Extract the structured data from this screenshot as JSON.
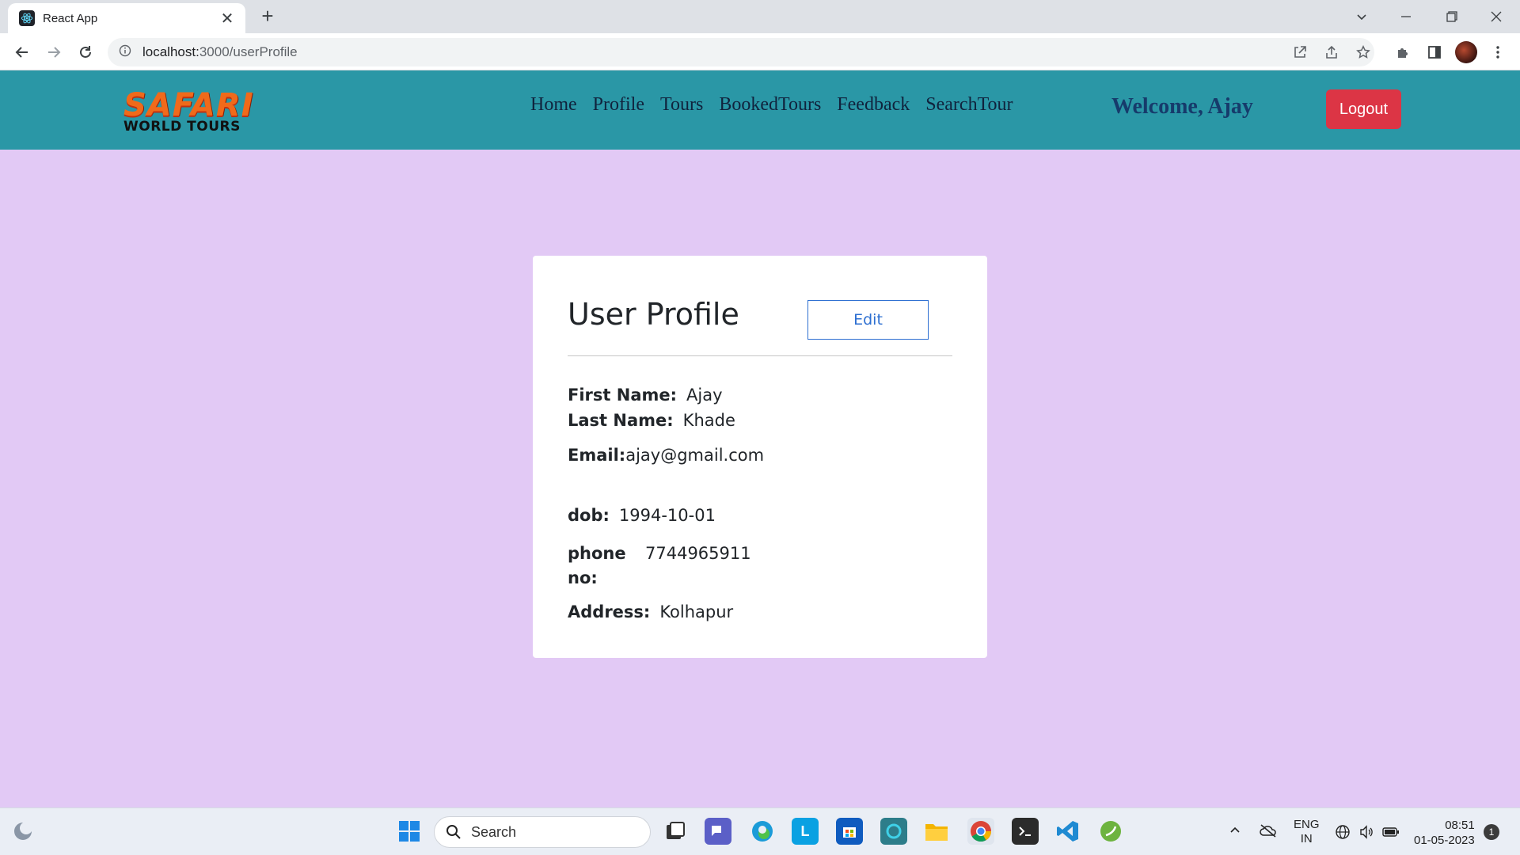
{
  "browser": {
    "tab_title": "React App",
    "new_tab": "+",
    "url_host": "localhost:",
    "url_path": "3000/userProfile"
  },
  "navbar": {
    "logo_top": "SAFARI",
    "logo_bottom": "WORLD TOURS",
    "menu": [
      "Home",
      "Profile",
      "Tours",
      "BookedTours",
      "Feedback",
      "SearchTour"
    ],
    "welcome": "Welcome, Ajay",
    "logout": "Logout",
    "bg_color": "#2a97a6",
    "logout_color": "#dc3545"
  },
  "profile": {
    "title": "User Profile",
    "edit_label": "Edit",
    "first_name_label": "First Name:",
    "first_name": "Ajay",
    "last_name_label": "Last Name:",
    "last_name": "Khade",
    "email_label": "Email:",
    "email": "ajay@gmail.com",
    "dob_label": "dob:",
    "dob": "1994-10-01",
    "phone_label": "phone no:",
    "phone": "7744965911",
    "address_label": "Address:",
    "address": "Kolhapur"
  },
  "page": {
    "bg_color": "#e2c9f5"
  },
  "taskbar": {
    "search_label": "Search",
    "lang_top": "ENG",
    "lang_bottom": "IN",
    "time": "08:51",
    "date": "01-05-2023",
    "notifications": "1"
  }
}
